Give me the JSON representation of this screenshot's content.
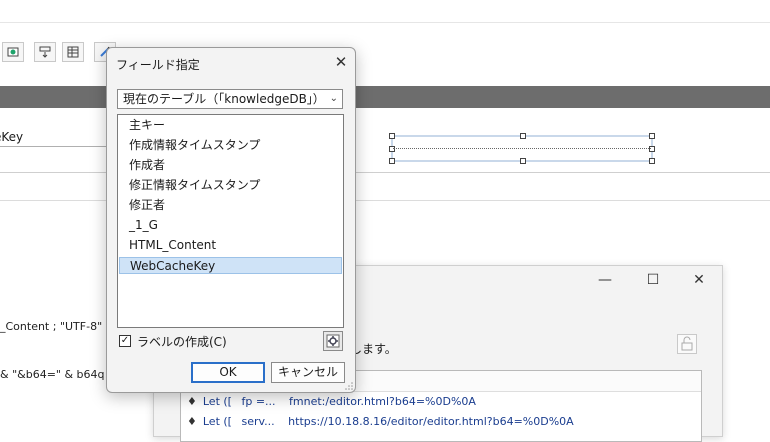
{
  "background": {
    "field_label": "eKey",
    "code_lines": [
      "_Content ; \"UTF-8\" ;",
      "& \"&b64=\" & b64q"
    ]
  },
  "script_window": {
    "controls": {
      "minimize": "—",
      "maximize": "☐",
      "close": "✕"
    },
    "message": "します。",
    "steps": [
      {
        "marker": "♦",
        "step": "Let ([",
        "var": "fp =...",
        "value": "fmnet:/editor.html?b64=%0D%0A"
      },
      {
        "marker": "♦",
        "step": "Let ([",
        "var": "serv...",
        "value": "https://10.18.8.16/editor/editor.html?b64=%0D%0A"
      }
    ]
  },
  "dialog": {
    "title": "フィールド指定",
    "close_glyph": "✕",
    "table_select": {
      "value": "現在のテーブル（「knowledgeDB」）",
      "chevron": "⌄"
    },
    "fields": [
      "主キー",
      "作成情報タイムスタンプ",
      "作成者",
      "修正情報タイムスタンプ",
      "修正者",
      "_1_G",
      "HTML_Content",
      "WebCacheKey"
    ],
    "selected_field": "WebCacheKey",
    "create_label": {
      "label": "ラベルの作成(C)",
      "checked": true,
      "mark": "✓"
    },
    "ok_label": "OK",
    "cancel_label": "キャンセル"
  },
  "colors": {
    "header_band": "#6d6d6d",
    "selection": "#cfe3f7",
    "ok_border": "#2a6fc9"
  }
}
